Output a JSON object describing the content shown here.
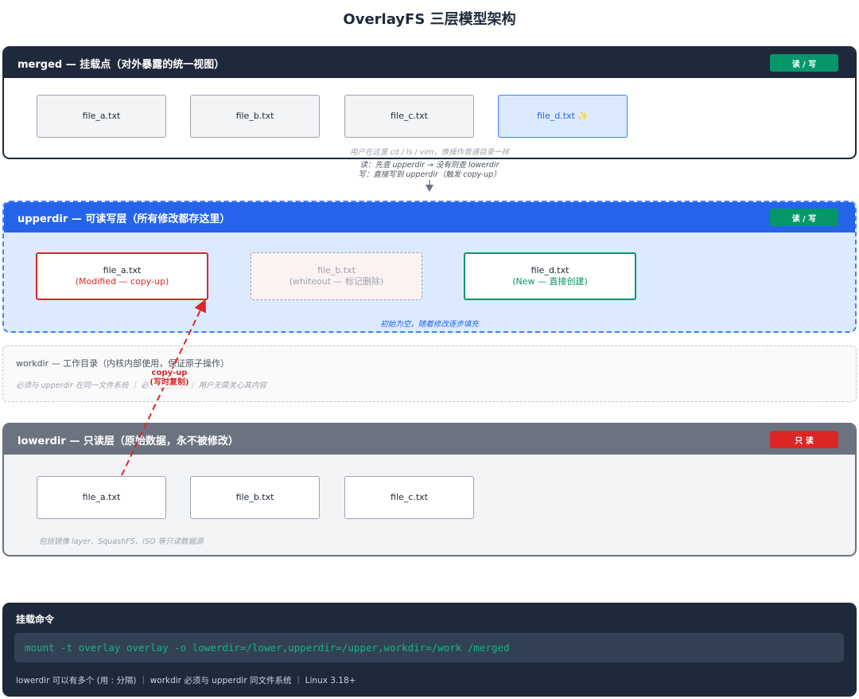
{
  "title": "OverlayFS 三层模型架构",
  "merged": {
    "header": "merged — 挂载点（对外暴露的统一视图）",
    "badge": "读 / 写",
    "files": [
      "file_a.txt",
      "file_b.txt",
      "file_c.txt",
      "file_d.txt ✨"
    ],
    "hint": "用户在这里 cd / ls / vim，像操作普通目录一样"
  },
  "flow": {
    "read": "读：先查 upperdir → 没有则查 lowerdir",
    "write": "写：直接写到 upperdir（触发 copy-up）"
  },
  "upper": {
    "header": "upperdir — 可读写层（所有修改都存这里）",
    "badge": "读 / 写",
    "file_a": {
      "name": "file_a.txt",
      "note": "(Modified — copy-up)"
    },
    "file_b": {
      "name": "file_b.txt",
      "note": "(whiteout — 标记删除)"
    },
    "file_d": {
      "name": "file_d.txt",
      "note": "(New — 直接创建)"
    },
    "hint": "初始为空，随着修改逐步填充"
  },
  "workdir": {
    "title": "workdir — 工作目录（内核内部使用，保证原子操作）",
    "hint": "必须与 upperdir 在同一文件系统 ｜ 必须是空目录 ｜ 用户无需关心其内容"
  },
  "copyup": {
    "line1": "copy-up",
    "line2": "(写时复制)"
  },
  "lower": {
    "header": "lowerdir — 只读层（原始数据，永不被修改）",
    "badge": "只 读",
    "files": [
      "file_a.txt",
      "file_b.txt",
      "file_c.txt"
    ],
    "hint": "包括镜像 layer、SquashFS、ISO 等只读数据源"
  },
  "command": {
    "title": "挂载命令",
    "code": "mount -t overlay overlay -o lowerdir=/lower,upperdir=/upper,workdir=/work /merged",
    "note": "lowerdir 可以有多个 (用 : 分隔) ｜ workdir 必须与 upperdir 同文件系统 ｜ Linux 3.18+"
  },
  "colors": {
    "dark": "#1e293b",
    "blue": "#2563eb",
    "green": "#059669",
    "red": "#dc2626",
    "gray": "#6b7280"
  }
}
